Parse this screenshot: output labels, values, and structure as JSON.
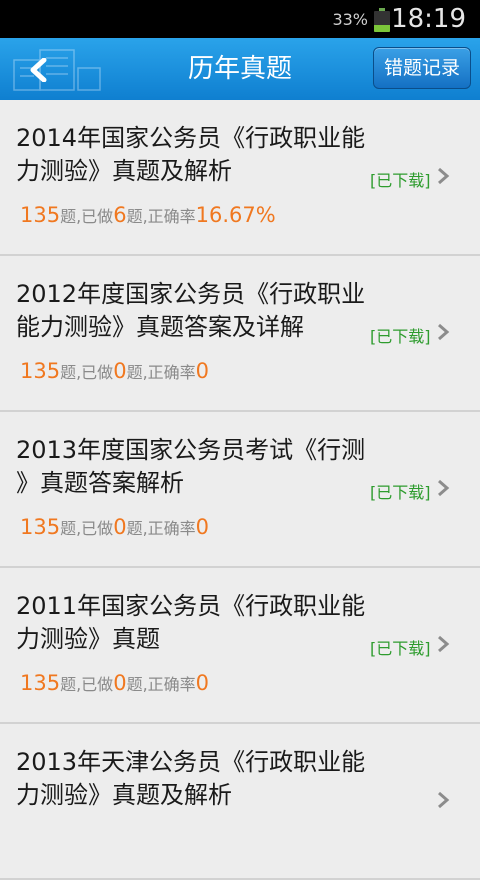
{
  "status_bar": {
    "battery_percent": "33%",
    "battery_level": 0.33,
    "time": "18:19"
  },
  "header": {
    "title": "历年真题",
    "right_button_label": "错题记录"
  },
  "items": [
    {
      "title_line1": "2014年国家公务员《行政职业能",
      "title_line2": "力测验》真题及解析",
      "status": "[已下载]",
      "total": "135",
      "total_suffix": "题,已做",
      "done": "6",
      "done_suffix": "题,正确率",
      "rate": "16.67%"
    },
    {
      "title_line1": "2012年度国家公务员《行政职业",
      "title_line2": "能力测验》真题答案及详解",
      "status": "[已下载]",
      "total": "135",
      "total_suffix": "题,已做",
      "done": "0",
      "done_suffix": "题,正确率",
      "rate": "0"
    },
    {
      "title_line1": "2013年度国家公务员考试《行测",
      "title_line2": "》真题答案解析",
      "status": "[已下载]",
      "total": "135",
      "total_suffix": "题,已做",
      "done": "0",
      "done_suffix": "题,正确率",
      "rate": "0"
    },
    {
      "title_line1": "2011年国家公务员《行政职业能",
      "title_line2": "力测验》真题",
      "status": "[已下载]",
      "total": "135",
      "total_suffix": "题,已做",
      "done": "0",
      "done_suffix": "题,正确率",
      "rate": "0"
    },
    {
      "title_line1": "2013年天津公务员《行政职业能",
      "title_line2": "力测验》真题及解析",
      "status": "",
      "total": "",
      "total_suffix": "",
      "done": "",
      "done_suffix": "",
      "rate": ""
    }
  ],
  "colors": {
    "accent_orange": "#f07820",
    "downloaded_green": "#2e9c2e",
    "header_blue": "#1a8fdc"
  },
  "icons": {
    "back": "chevron-left-icon",
    "item_arrow": "chevron-right-icon",
    "battery": "battery-icon"
  }
}
